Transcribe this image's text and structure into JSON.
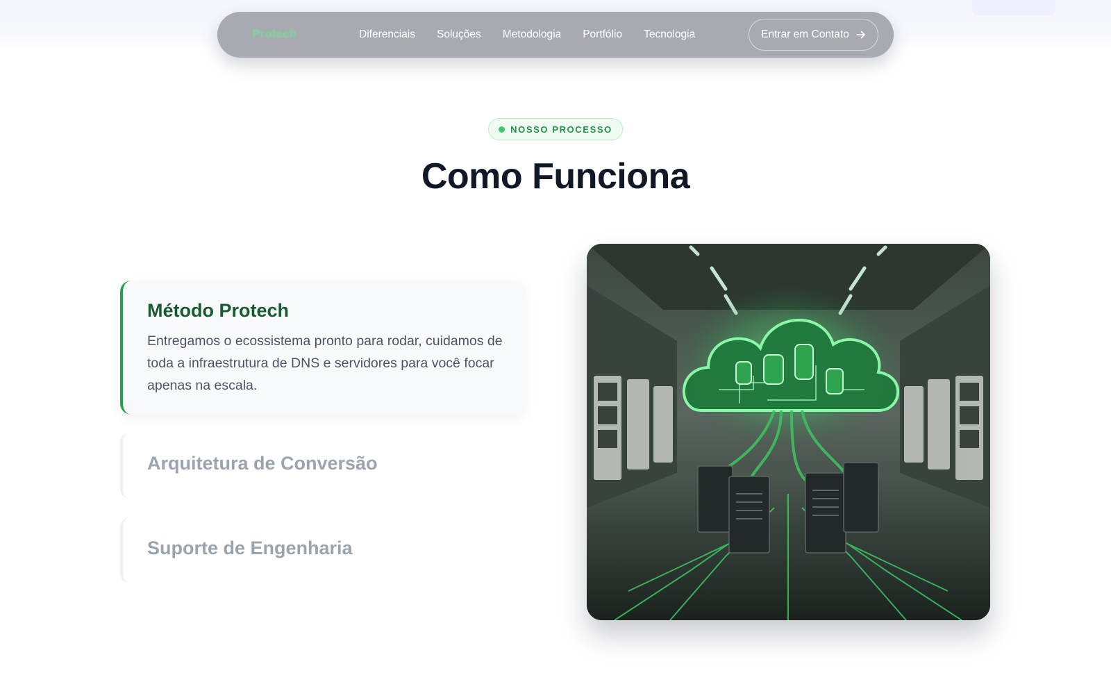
{
  "nav": {
    "logo": "Protech",
    "links": [
      "Diferenciais",
      "Soluções",
      "Metodologia",
      "Portfólio",
      "Tecnologia"
    ],
    "cta_label": "Entrar em Contato"
  },
  "section": {
    "badge": "NOSSO PROCESSO",
    "title": "Como Funciona"
  },
  "steps": [
    {
      "title": "Método Protech",
      "description": "Entregamos o ecossistema pronto para rodar, cuidamos de toda a infraestrutura de DNS e servidores para você focar apenas na escala.",
      "active": true
    },
    {
      "title": "Arquitetura de Conversão",
      "active": false
    },
    {
      "title": "Suporte de Engenharia",
      "active": false
    }
  ],
  "colors": {
    "accent": "#22a04f",
    "badge_text": "#22924a",
    "title": "#111827",
    "active_step_title": "#1a5a32",
    "inactive_step_title": "#9aa3ae"
  }
}
